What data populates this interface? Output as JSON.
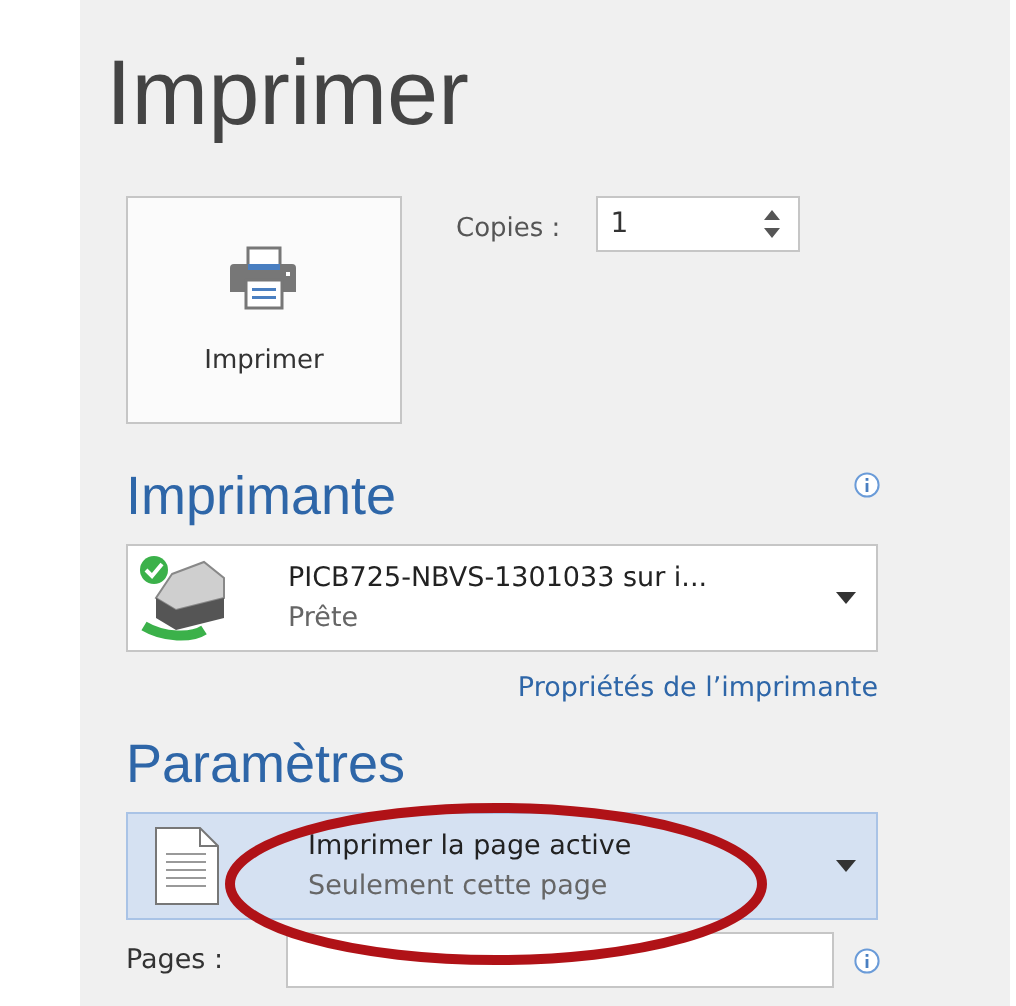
{
  "title": "Imprimer",
  "print_button": {
    "label": "Imprimer"
  },
  "copies": {
    "label": "Copies :",
    "value": "1"
  },
  "printer_section": {
    "heading": "Imprimante",
    "dropdown": {
      "name": "PICB725-NBVS-1301033 sur i...",
      "status": "Prête",
      "highlighted": false
    },
    "link": "Propriétés de l’imprimante"
  },
  "settings_section": {
    "heading": "Paramètres",
    "dropdown": {
      "name": "Imprimer la page active",
      "detail": "Seulement cette page",
      "highlighted": true
    }
  },
  "pages": {
    "label": "Pages :"
  }
}
